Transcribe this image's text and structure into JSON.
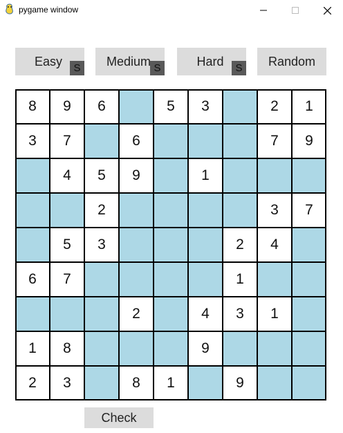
{
  "window": {
    "title": "pygame window",
    "icon": "pygame-snake-icon",
    "controls": [
      "minimize-icon",
      "maximize-icon",
      "close-icon"
    ]
  },
  "modes": [
    {
      "label": "Easy",
      "solve_label": "S"
    },
    {
      "label": "Medium",
      "solve_label": "S"
    },
    {
      "label": "Hard",
      "solve_label": "S"
    },
    {
      "label": "Random"
    }
  ],
  "board": {
    "rows": [
      [
        "8",
        "9",
        "6",
        "",
        "5",
        "3",
        "",
        "2",
        "1"
      ],
      [
        "3",
        "7",
        "",
        "6",
        "",
        "",
        "",
        "7",
        "9"
      ],
      [
        "",
        "4",
        "5",
        "9",
        "",
        "1",
        "",
        "",
        ""
      ],
      [
        "",
        "",
        "2",
        "",
        "",
        "",
        "",
        "3",
        "7"
      ],
      [
        "",
        "5",
        "3",
        "",
        "",
        "",
        "2",
        "4",
        ""
      ],
      [
        "6",
        "7",
        "",
        "",
        "",
        "",
        "1",
        "",
        ""
      ],
      [
        "",
        "",
        "",
        "2",
        "",
        "4",
        "3",
        "1",
        ""
      ],
      [
        "1",
        "8",
        "",
        "",
        "",
        "9",
        "",
        "",
        ""
      ],
      [
        "2",
        "3",
        "",
        "8",
        "1",
        "",
        "9",
        "",
        ""
      ]
    ]
  },
  "check_button": {
    "label": "Check"
  },
  "colors": {
    "blank_cell": "#add8e6",
    "filled_cell": "#ffffff",
    "button": "#dcdcdc",
    "solve_badge": "#595959"
  }
}
